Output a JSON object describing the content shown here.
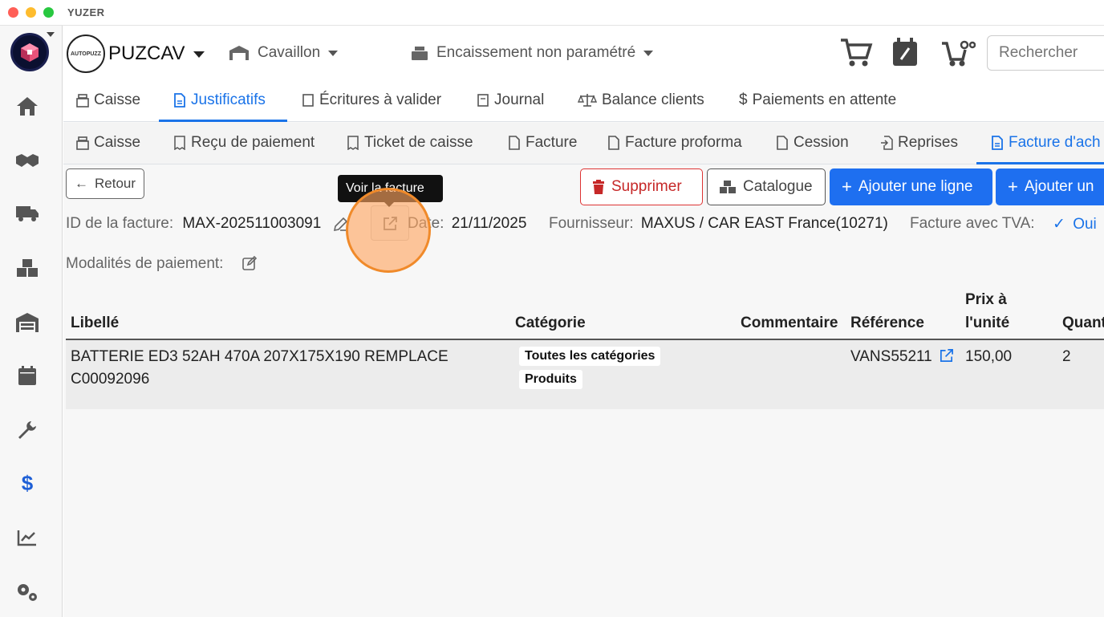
{
  "app": {
    "title": "YUZER"
  },
  "header": {
    "org_name": "PUZCAV",
    "avatar_text": "AUTOPUZZ",
    "location": "Cavaillon",
    "register": "Encaissement non paramétré",
    "search_placeholder": "Rechercher"
  },
  "tabs_main": [
    {
      "label": "Caisse"
    },
    {
      "label": "Justificatifs"
    },
    {
      "label": "Écritures à valider"
    },
    {
      "label": "Journal"
    },
    {
      "label": "Balance clients"
    },
    {
      "label": "Paiements en attente"
    }
  ],
  "tabs_sub": [
    {
      "label": "Caisse"
    },
    {
      "label": "Reçu de paiement"
    },
    {
      "label": "Ticket de caisse"
    },
    {
      "label": "Facture"
    },
    {
      "label": "Facture proforma"
    },
    {
      "label": "Cession"
    },
    {
      "label": "Reprises"
    },
    {
      "label": "Facture d'ach"
    }
  ],
  "toolbar": {
    "back": "Retour",
    "delete": "Supprimer",
    "catalog": "Catalogue",
    "add_line": "Ajouter une ligne",
    "add_other": "Ajouter un"
  },
  "tooltip": "Voir la facture",
  "invoice": {
    "id_label": "ID de la facture:",
    "id_value": "MAX-202511003091",
    "date_label": "Date:",
    "date_value": "21/11/2025",
    "supplier_label": "Fournisseur:",
    "supplier_value": "MAXUS / CAR EAST France(10271)",
    "vat_label": "Facture avec TVA:",
    "vat_value": "Oui",
    "payment_label": "Modalités de paiement:"
  },
  "table": {
    "headers": {
      "label": "Libellé",
      "category": "Catégorie",
      "comment": "Commentaire",
      "reference": "Référence",
      "unit_price_1": "Prix à",
      "unit_price_2": "l'unité",
      "quantity": "Quant"
    },
    "rows": [
      {
        "label_1": "BATTERIE ED3 52AH 470A 207X175X190 REMPLACE",
        "label_2": "C00092096",
        "category_1": "Toutes les catégories",
        "category_2": "Produits",
        "reference": "VANS55211",
        "unit_price": "150,00",
        "quantity": "2"
      }
    ]
  },
  "colors": {
    "accent": "#1e6ff0",
    "danger": "#c62828",
    "click_marker": "#f08a2a"
  }
}
